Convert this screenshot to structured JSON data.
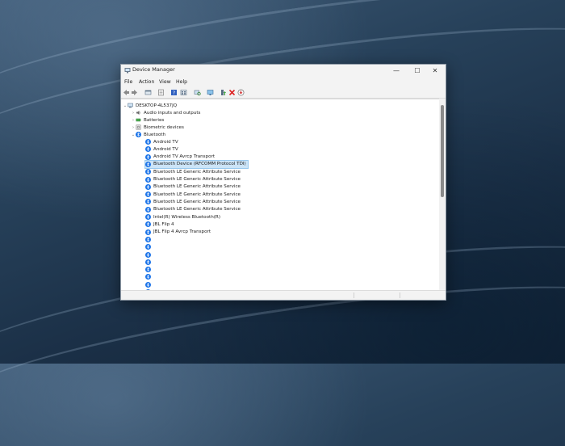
{
  "window": {
    "title": "Device Manager",
    "controls": {
      "minimize": "—",
      "maximize": "☐",
      "close": "✕"
    }
  },
  "menu": [
    "File",
    "Action",
    "View",
    "Help"
  ],
  "toolbar": {
    "buttons": [
      "back-icon",
      "forward-icon",
      "properties-icon",
      "device-list-icon",
      "help-icon",
      "view-icon",
      "scan-icon",
      "monitor-icon",
      "update-driver-icon",
      "uninstall-icon",
      "download-icon"
    ]
  },
  "tree": {
    "root": "DESKTOP-4L537JQ",
    "categories": [
      "Audio inputs and outputs",
      "Batteries",
      "Biometric devices",
      "Bluetooth"
    ],
    "bluetooth_devices": [
      "Android TV",
      "Android TV",
      "Android TV Avrcp Transport",
      "Bluetooth Device (RFCOMM Protocol TDI)",
      "Bluetooth LE Generic Attribute Service",
      "Bluetooth LE Generic Attribute Service",
      "Bluetooth LE Generic Attribute Service",
      "Bluetooth LE Generic Attribute Service",
      "Bluetooth LE Generic Attribute Service",
      "Bluetooth LE Generic Attribute Service",
      "Intel(R) Wireless Bluetooth(R)",
      "JBL Flip 4",
      "JBL Flip 4 Avrcp Transport",
      "",
      "",
      "",
      "",
      "",
      "",
      "",
      ""
    ],
    "selected_device": "Bluetooth Device (RFCOMM Protocol TDI)"
  },
  "colors": {
    "bluetooth": "#1a73e8",
    "selection": "#cce4f7"
  }
}
